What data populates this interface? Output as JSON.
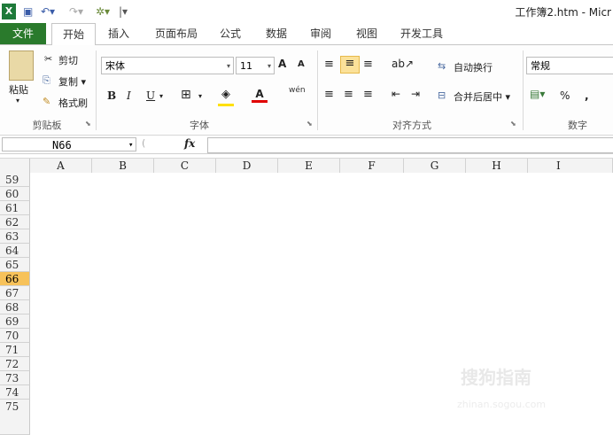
{
  "title": "工作簿2.htm - Micr",
  "tabs": [
    "文件",
    "开始",
    "插入",
    "页面布局",
    "公式",
    "数据",
    "审阅",
    "视图",
    "开发工具"
  ],
  "clipboard": {
    "paste": "粘贴",
    "cut": "剪切",
    "copy": "复制 ▾",
    "format_painter": "格式刷",
    "group": "剪贴板"
  },
  "font": {
    "name": "宋体",
    "size": "11",
    "bold": "B",
    "italic": "I",
    "underline": "U",
    "grow": "A",
    "shrink": "A",
    "color_letter": "A",
    "wen": "wén",
    "group": "字体"
  },
  "align": {
    "wrap": "自动换行",
    "merge": "合并后居中 ▾",
    "group": "对齐方式"
  },
  "number": {
    "format": "常规",
    "percent": "%",
    "comma": ",",
    "group": "数字"
  },
  "formula": {
    "namebox": "N66",
    "fx": "fx",
    "content": ""
  },
  "columns": [
    "A",
    "B",
    "C",
    "D",
    "E",
    "F",
    "G",
    "H",
    "I"
  ],
  "rows": [
    "59",
    "60",
    "61",
    "62",
    "63",
    "64",
    "65",
    "66",
    "67",
    "68",
    "69",
    "70",
    "71",
    "72",
    "73",
    "74",
    "75"
  ],
  "selected_row": "66",
  "watermark": {
    "main": "搜狗指南",
    "sub": "zhinan.sogou.com"
  },
  "colors": {
    "file_tab": "#2a7a2c",
    "selected_row": "#f7c25a"
  }
}
